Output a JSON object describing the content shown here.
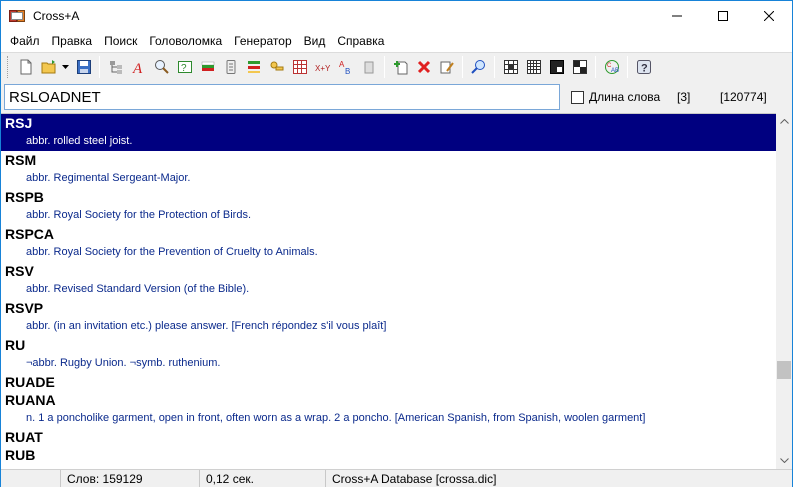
{
  "window": {
    "title": "Cross+A"
  },
  "menu": [
    "Файл",
    "Правка",
    "Поиск",
    "Головоломка",
    "Генератор",
    "Вид",
    "Справка"
  ],
  "toolbar": {
    "icons": [
      "new-file-icon",
      "open-folder-icon",
      "dropdown-arrow-icon",
      "save-icon",
      "tree-icon",
      "spell-a-icon",
      "find-word-icon",
      "question-icon",
      "flag-icon",
      "list-icon",
      "anagram-icon",
      "keys-icon",
      "grid-icon",
      "xy-formula-icon",
      "ab-icon",
      "clipboard-icon",
      "add-word-icon",
      "delete-icon",
      "edit-icon",
      "search-dictionary-icon",
      "crossword-grid-icon",
      "crossword-numbered-icon",
      "crossword-black-icon",
      "crossword-check-icon",
      "cab-convert-icon",
      "help-icon"
    ]
  },
  "search": {
    "value": "RSLOADNET",
    "word_length_label": "Длина слова",
    "match_count": "[3]",
    "total_count": "[120774]"
  },
  "entries": [
    {
      "word": "RSJ",
      "def": "abbr. rolled steel joist.",
      "selected": true
    },
    {
      "word": "RSM",
      "def": "abbr. Regimental Sergeant-Major."
    },
    {
      "word": "RSPB",
      "def": "abbr. Royal Society for the Protection of Birds."
    },
    {
      "word": "RSPCA",
      "def": "abbr. Royal Society for the Prevention of Cruelty to Animals."
    },
    {
      "word": "RSV",
      "def": "abbr. Revised Standard Version (of the Bible)."
    },
    {
      "word": "RSVP",
      "def": "abbr. (in an invitation etc.) please answer. [French répondez s'il vous plaît]"
    },
    {
      "word": "RU",
      "def": "¬abbr. Rugby Union. ¬symb. ruthenium."
    },
    {
      "word": "RUADE",
      "def": ""
    },
    {
      "word": "RUANA",
      "def": "n. 1 a poncholike garment, open in front, often worn as a wrap. 2 a poncho. [American Spanish, from Spanish, woolen garment]"
    },
    {
      "word": "RUAT",
      "def": ""
    },
    {
      "word": "RUB",
      "def": ""
    }
  ],
  "status": {
    "words": "Слов: 159129",
    "time": "0,12 сек.",
    "database": "Cross+A Database [crossa.dic]"
  },
  "colors": {
    "selection": "#000080",
    "definition": "#0b2a8c",
    "accent": "#1783d8"
  }
}
